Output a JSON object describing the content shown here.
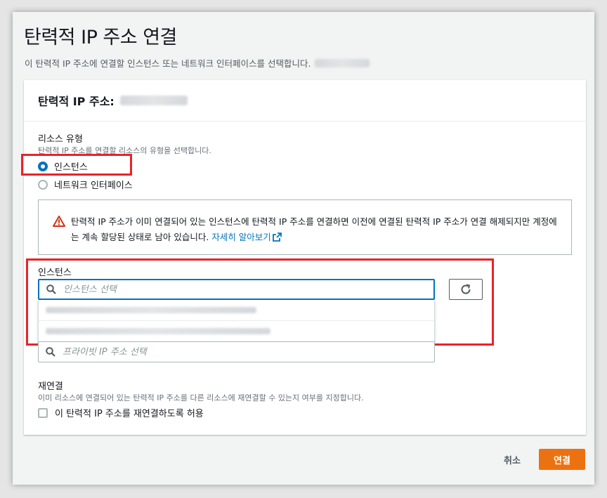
{
  "dialog": {
    "title": "탄력적 IP 주소 연결",
    "description": "이 탄력적 IP 주소에 연결할 인스턴스 또는 네트워크 인터페이스를 선택합니다."
  },
  "card": {
    "header_title": "탄력적 IP 주소:"
  },
  "resource_type": {
    "label": "리소스 유형",
    "hint": "탄력적 IP 주소를 연결할 리소스의 유형을 선택합니다.",
    "options": [
      {
        "label": "인스턴스",
        "selected": true
      },
      {
        "label": "네트워크 인터페이스",
        "selected": false
      }
    ]
  },
  "alert": {
    "text": "탄력적 IP 주소가 이미 연결되어 있는 인스턴스에 탄력적 IP 주소를 연결하면 이전에 연결된 탄력적 IP 주소가 연결 해제되지만 계정에는 계속 할당된 상태로 남아 있습니다.",
    "link_text": "자세히 알아보기",
    "icon": "warning-icon"
  },
  "instance": {
    "label": "인스턴스",
    "placeholder": "인스턴스 선택"
  },
  "private_ip": {
    "placeholder": "프라이빗 IP 주소 선택"
  },
  "reassociation": {
    "label": "재연결",
    "hint": "이미 리소스에 연결되어 있는 탄력적 IP 주소를 다른 리소스에 재연결할 수 있는지 여부를 지정합니다.",
    "checkbox_label": "이 탄력적 IP 주소를 재연결하도록 허용",
    "checked": false
  },
  "footer": {
    "cancel_label": "취소",
    "primary_label": "연결"
  },
  "colors": {
    "primary": "#ec7211",
    "link": "#0073bb",
    "highlight": "#e8232a",
    "warning": "#d13212"
  }
}
